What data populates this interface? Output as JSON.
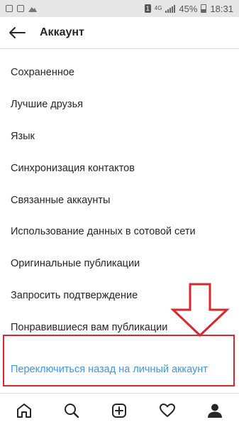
{
  "status_bar": {
    "sim": "1",
    "network": "4G",
    "battery": "45%",
    "time": "18:31"
  },
  "header": {
    "title": "Аккаунт"
  },
  "menu": {
    "items": [
      {
        "label": "Сохраненное"
      },
      {
        "label": "Лучшие друзья"
      },
      {
        "label": "Язык"
      },
      {
        "label": "Синхронизация контактов"
      },
      {
        "label": "Связанные аккаунты"
      },
      {
        "label": "Использование данных в сотовой сети"
      },
      {
        "label": "Оригинальные публикации"
      },
      {
        "label": "Запросить подтверждение"
      },
      {
        "label": "Понравившиеся вам публикации"
      },
      {
        "label": "Переключиться назад на личный аккаунт"
      }
    ]
  },
  "colors": {
    "highlight_link": "#3897f0",
    "annotation_red": "#d9272e"
  },
  "tabbar": {
    "icons": [
      "home-icon",
      "search-icon",
      "new-post-icon",
      "activity-heart-icon",
      "profile-icon"
    ]
  }
}
